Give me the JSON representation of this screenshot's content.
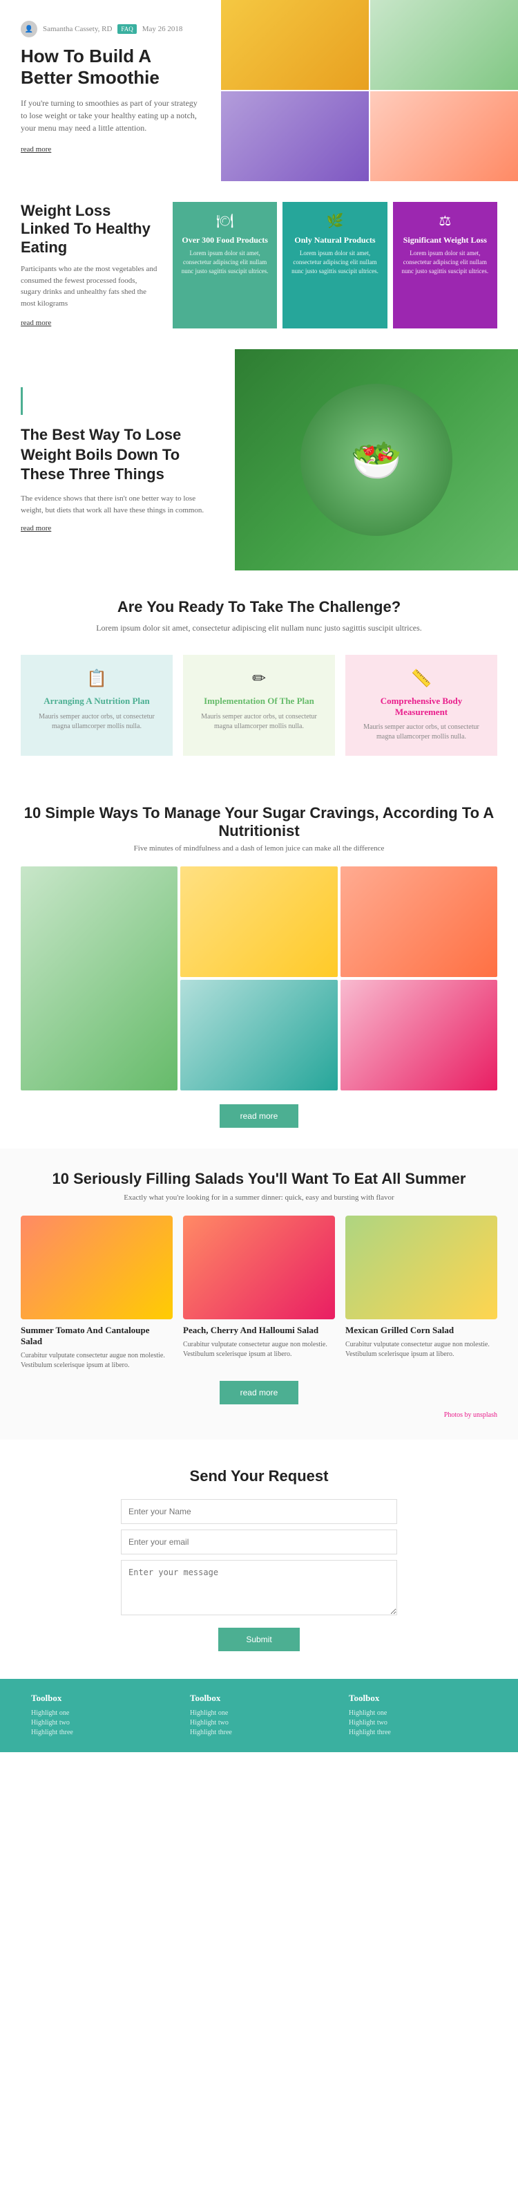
{
  "meta": {
    "author": "Samantha Cassety, RD",
    "date": "May 26 2018",
    "tag": "FAQ"
  },
  "hero": {
    "title": "How To Build A Better Smoothie",
    "description": "If you're turning to smoothies as part of your strategy to lose weight or take your healthy eating up a notch, your menu may need a little attention.",
    "read_more": "read more"
  },
  "weight_loss": {
    "title": "Weight Loss Linked To Healthy Eating",
    "description": "Participants who ate the most vegetables and consumed the fewest processed foods, sugary drinks and unhealthy fats shed the most kilograms",
    "read_more": "read more",
    "cards": [
      {
        "icon": "🍽",
        "title": "Over 300 Food Products",
        "description": "Lorem ipsum dolor sit amet, consectetur adipiscing elit nullam nunc justo sagittis suscipit ultrices."
      },
      {
        "icon": "🌿",
        "title": "Only Natural Products",
        "description": "Lorem ipsum dolor sit amet, consectetur adipiscing elit nullam nunc justo sagittis suscipit ultrices."
      },
      {
        "icon": "⚖",
        "title": "Significant Weight Loss",
        "description": "Lorem ipsum dolor sit amet, consectetur adipiscing elit nullam nunc justo sagittis suscipit ultrices."
      }
    ]
  },
  "banner": {
    "title": "The Best Way To Lose Weight Boils Down To These Three Things",
    "description": "The evidence shows that there isn't one better way to lose weight, but diets that work all have these things in common.",
    "read_more": "read more"
  },
  "challenge": {
    "title": "Are You Ready To Take The Challenge?",
    "subtitle": "Lorem ipsum dolor sit amet, consectetur adipiscing elit nullam nunc justo sagittis suscipit ultrices.",
    "cards": [
      {
        "icon": "📋",
        "title": "Arranging A Nutrition Plan",
        "description": "Mauris semper auctor orbs, ut consectetur magna ullamcorper mollis nulla.",
        "color": "light-teal",
        "title_color": "teal-text"
      },
      {
        "icon": "✏",
        "title": "Implementation Of The Plan",
        "description": "Mauris semper auctor orbs, ut consectetur magna ullamcorper mollis nulla.",
        "color": "light-green",
        "title_color": "green-text"
      },
      {
        "icon": "📏",
        "title": "Comprehensive Body Measurement",
        "description": "Mauris semper auctor orbs, ut consectetur magna ullamcorper mollis nulla.",
        "color": "light-pink",
        "title_color": "pink-text"
      }
    ]
  },
  "sugar": {
    "title": "10 Simple Ways To Manage Your Sugar Cravings, According To A Nutritionist",
    "subtitle": "Five minutes of mindfulness and a dash of lemon juice can make all the difference",
    "read_more": "read more"
  },
  "salads": {
    "title": "10 Seriously Filling Salads You'll Want To Eat All Summer",
    "subtitle": "Exactly what you're looking for in a summer dinner: quick, easy and bursting with flavor",
    "read_more": "read more",
    "photos_credit": "Photos by",
    "photos_credit_name": "unsplash",
    "items": [
      {
        "title": "Summer Tomato And Cantaloupe Salad",
        "description": "Curabitur vulputate consectetur augue non molestie. Vestibulum scelerisque ipsum at libero."
      },
      {
        "title": "Peach, Cherry And Halloumi Salad",
        "description": "Curabitur vulputate consectetur augue non molestie. Vestibulum scelerisque ipsum at libero."
      },
      {
        "title": "Mexican Grilled Corn Salad",
        "description": "Curabitur vulputate consectetur augue non molestie. Vestibulum scelerisque ipsum at libero."
      }
    ]
  },
  "contact": {
    "title": "Send Your Request",
    "form": {
      "name_placeholder": "Enter your Name",
      "email_placeholder": "Enter your email",
      "message_placeholder": "Enter your message",
      "submit_label": "Submit"
    }
  },
  "footer": {
    "columns": [
      {
        "title": "Toolbox",
        "links": [
          "Highlight one",
          "Highlight two",
          "Highlight three"
        ]
      },
      {
        "title": "Toolbox",
        "links": [
          "Highlight one",
          "Highlight two",
          "Highlight three"
        ]
      },
      {
        "title": "Toolbox",
        "links": [
          "Highlight one",
          "Highlight two",
          "Highlight three"
        ]
      }
    ]
  }
}
